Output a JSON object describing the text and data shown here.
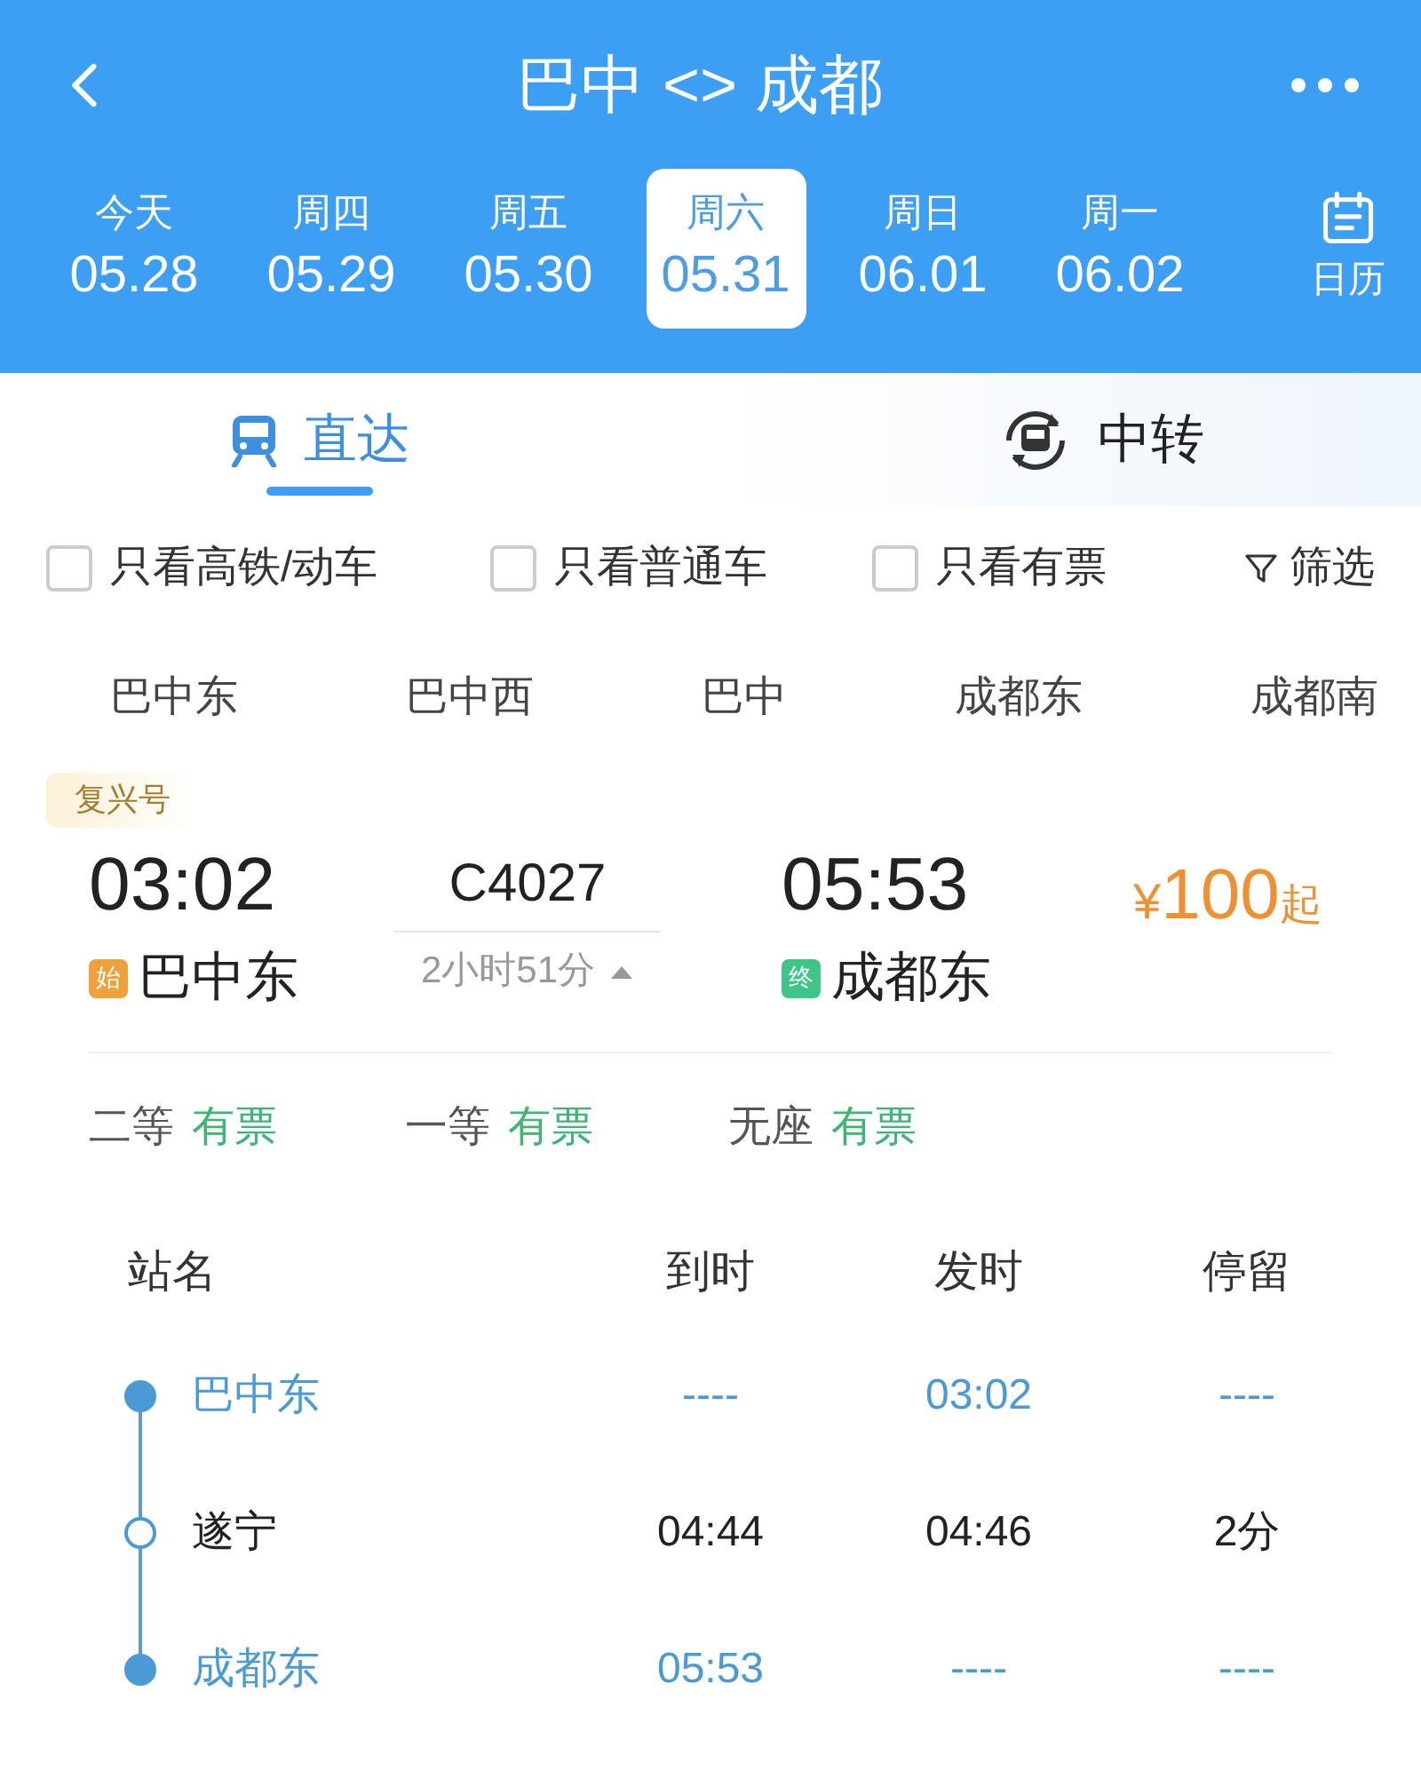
{
  "header": {
    "title": "巴中 <> 成都",
    "calendar_label": "日历"
  },
  "dates": [
    {
      "weekday": "今天",
      "date": "05.28",
      "selected": false
    },
    {
      "weekday": "周四",
      "date": "05.29",
      "selected": false
    },
    {
      "weekday": "周五",
      "date": "05.30",
      "selected": false
    },
    {
      "weekday": "周六",
      "date": "05.31",
      "selected": true
    },
    {
      "weekday": "周日",
      "date": "06.01",
      "selected": false
    },
    {
      "weekday": "周一",
      "date": "06.02",
      "selected": false
    }
  ],
  "tabs": [
    {
      "label": "直达",
      "kind": "direct",
      "selected": true
    },
    {
      "label": "中转",
      "kind": "transfer",
      "selected": false
    }
  ],
  "filters": [
    {
      "label": "只看高铁/动车",
      "checked": false
    },
    {
      "label": "只看普通车",
      "checked": false
    },
    {
      "label": "只看有票",
      "checked": false
    }
  ],
  "filter_button": "筛选",
  "stations": [
    {
      "label": "巴中东",
      "selected": false
    },
    {
      "label": "巴中西",
      "selected": false
    },
    {
      "label": "巴中",
      "selected": false
    },
    {
      "label": "成都东",
      "selected": false
    },
    {
      "label": "成都南",
      "selected": false
    }
  ],
  "train": {
    "type_tag": "复兴号",
    "ends": [
      {
        "time": "03:02",
        "badge": "始",
        "color": "#f0a13c",
        "station": "巴中东"
      },
      {
        "time": "05:53",
        "badge": "终",
        "color": "#3fc48a",
        "station": "成都东"
      }
    ],
    "number": "C4027",
    "duration": "2小时51分",
    "expanded": true,
    "price_currency": "¥",
    "price_amount": "100",
    "price_suffix": "起",
    "seats": [
      {
        "class": "二等",
        "availability": "有票"
      },
      {
        "class": "一等",
        "availability": "有票"
      },
      {
        "class": "无座",
        "availability": "有票"
      }
    ]
  },
  "stops_table": {
    "columns": [
      "站名",
      "到时",
      "发时",
      "停留"
    ],
    "rows": [
      {
        "kind": "terminal",
        "station": "巴中东",
        "arrive": "----",
        "depart": "03:02",
        "stay": "----"
      },
      {
        "kind": "stop",
        "station": "遂宁",
        "arrive": "04:44",
        "depart": "04:46",
        "stay": "2分"
      },
      {
        "kind": "terminal",
        "station": "成都东",
        "arrive": "05:53",
        "depart": "----",
        "stay": "----"
      }
    ]
  }
}
